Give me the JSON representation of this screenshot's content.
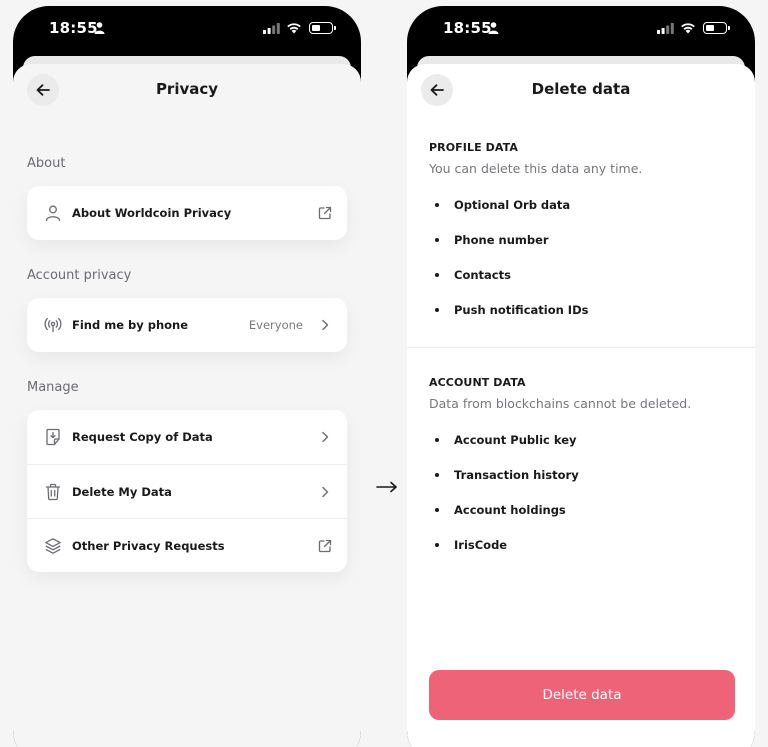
{
  "status_bar": {
    "time": "18:55"
  },
  "privacy_screen": {
    "title": "Privacy",
    "sections": [
      {
        "label": "About",
        "items": [
          {
            "label": "About Worldcoin Privacy",
            "icon": "person-icon",
            "right_icon": "external-link-icon"
          }
        ]
      },
      {
        "label": "Account privacy",
        "items": [
          {
            "label": "Find me by phone",
            "value": "Everyone",
            "icon": "broadcast-icon",
            "right_icon": "chevron-right-icon"
          }
        ]
      },
      {
        "label": "Manage",
        "items": [
          {
            "label": "Request Copy of Data",
            "icon": "document-download-icon",
            "right_icon": "chevron-right-icon"
          },
          {
            "label": "Delete My Data",
            "icon": "trash-icon",
            "right_icon": "chevron-right-icon"
          },
          {
            "label": "Other Privacy Requests",
            "icon": "layers-icon",
            "right_icon": "external-link-icon"
          }
        ]
      }
    ]
  },
  "delete_screen": {
    "title": "Delete data",
    "profile": {
      "heading": "PROFILE DATA",
      "subtitle": "You can delete this data any time.",
      "items": [
        "Optional Orb data",
        "Phone number",
        "Contacts",
        "Push notification IDs"
      ]
    },
    "account": {
      "heading": "ACCOUNT DATA",
      "subtitle": "Data from blockchains cannot be deleted.",
      "items": [
        "Account Public key",
        "Transaction history",
        "Account holdings",
        "IrisCode"
      ]
    },
    "delete_button": "Delete data"
  },
  "colors": {
    "accent": "#ef6378",
    "background": "#f5f5f6",
    "card": "#ffffff"
  }
}
